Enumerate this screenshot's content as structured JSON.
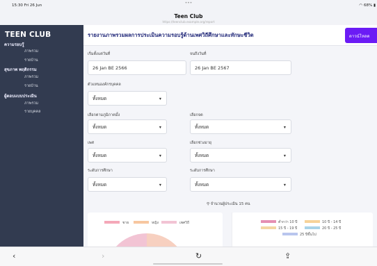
{
  "status": {
    "time": "15:30  Fri 26 Jun",
    "battery": "68%",
    "dots": "•••"
  },
  "browser": {
    "title": "Teen Club",
    "url": "https://teenclub.example.org/report"
  },
  "sidebar": {
    "brand": "TEEN CLUB",
    "sections": [
      {
        "label": "ความรอบรู้",
        "items": [
          "ภาพรวม",
          "รายบ้าน"
        ]
      },
      {
        "label": "สุขภาพ พฤติกรรม",
        "items": [
          "ภาพรวม",
          "รายบ้าน"
        ]
      },
      {
        "label": "ผู้ตอบแบบประเมิน",
        "items": [
          "ภาพรวม",
          "รายบุคคล"
        ]
      }
    ]
  },
  "header": {
    "title": "รายงานภาพรวมผลการประเมินความรอบรู้ด้านเพศวิถีศึกษาและทักษะชีวิต",
    "download_label": "ดาวน์โหลด"
  },
  "filters": {
    "start_date": {
      "label": "เริ่มตั้งแต่วันที่",
      "value": "26 Jan BE 2566"
    },
    "end_date": {
      "label": "จนถึงวันที่",
      "value": "26 Jan BE 2567"
    },
    "group": {
      "label": "ตัวแทนองค์กรบุคคล",
      "value": "ทั้งหมด"
    },
    "region": {
      "label": "เลือกตามภูมิภาคมั้ง",
      "value": "ทั้งหมด"
    },
    "province": {
      "label": "เลือกจต",
      "value": "ทั้งหมด"
    },
    "gender": {
      "label": "เพศ",
      "value": "ทั้งหมด"
    },
    "age": {
      "label": "เลือกช่วงอายุ",
      "value": "ทั้งหมด"
    },
    "education": {
      "label": "ระดับการศึกษา",
      "value": "ทั้งหมด"
    },
    "study_status": {
      "label": "ระดับการศึกษา",
      "value": "ทั้งหมด"
    }
  },
  "respondent_count": "จำนวนผู้ประเมิน 15 คน",
  "chart_left": {
    "legend": [
      {
        "label": "ชาย",
        "color": "#f4a8b8"
      },
      {
        "label": "หญิง",
        "color": "#f7c7a0"
      },
      {
        "label": "เพศวิถี",
        "color": "#f2c4d4"
      }
    ]
  },
  "chart_right": {
    "legend": [
      {
        "label": "ต่ำกว่า 10 ปี",
        "color": "#e58fb3"
      },
      {
        "label": "10 ปี - 14 ปี",
        "color": "#f6d39a"
      },
      {
        "label": "15 ปี - 19 ปี",
        "color": "#f4d6a3"
      },
      {
        "label": "20 ปี - 25 ปี",
        "color": "#a9d3e8"
      },
      {
        "label": "25 ปีขึ้นไป",
        "color": "#b9c6ee"
      }
    ]
  },
  "toolbar": {
    "back": "‹",
    "forward": "›",
    "reload": "↻",
    "share": "⇪"
  },
  "colors": {
    "sidebar": "#323b50",
    "accent": "#6b1bf5",
    "title": "#232a7a"
  }
}
